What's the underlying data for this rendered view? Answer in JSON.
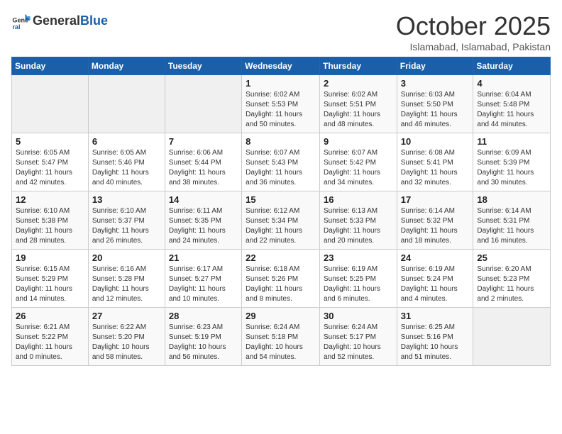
{
  "header": {
    "logo_general": "General",
    "logo_blue": "Blue",
    "month": "October 2025",
    "location": "Islamabad, Islamabad, Pakistan"
  },
  "weekdays": [
    "Sunday",
    "Monday",
    "Tuesday",
    "Wednesday",
    "Thursday",
    "Friday",
    "Saturday"
  ],
  "weeks": [
    [
      {
        "day": "",
        "info": ""
      },
      {
        "day": "",
        "info": ""
      },
      {
        "day": "",
        "info": ""
      },
      {
        "day": "1",
        "info": "Sunrise: 6:02 AM\nSunset: 5:53 PM\nDaylight: 11 hours\nand 50 minutes."
      },
      {
        "day": "2",
        "info": "Sunrise: 6:02 AM\nSunset: 5:51 PM\nDaylight: 11 hours\nand 48 minutes."
      },
      {
        "day": "3",
        "info": "Sunrise: 6:03 AM\nSunset: 5:50 PM\nDaylight: 11 hours\nand 46 minutes."
      },
      {
        "day": "4",
        "info": "Sunrise: 6:04 AM\nSunset: 5:48 PM\nDaylight: 11 hours\nand 44 minutes."
      }
    ],
    [
      {
        "day": "5",
        "info": "Sunrise: 6:05 AM\nSunset: 5:47 PM\nDaylight: 11 hours\nand 42 minutes."
      },
      {
        "day": "6",
        "info": "Sunrise: 6:05 AM\nSunset: 5:46 PM\nDaylight: 11 hours\nand 40 minutes."
      },
      {
        "day": "7",
        "info": "Sunrise: 6:06 AM\nSunset: 5:44 PM\nDaylight: 11 hours\nand 38 minutes."
      },
      {
        "day": "8",
        "info": "Sunrise: 6:07 AM\nSunset: 5:43 PM\nDaylight: 11 hours\nand 36 minutes."
      },
      {
        "day": "9",
        "info": "Sunrise: 6:07 AM\nSunset: 5:42 PM\nDaylight: 11 hours\nand 34 minutes."
      },
      {
        "day": "10",
        "info": "Sunrise: 6:08 AM\nSunset: 5:41 PM\nDaylight: 11 hours\nand 32 minutes."
      },
      {
        "day": "11",
        "info": "Sunrise: 6:09 AM\nSunset: 5:39 PM\nDaylight: 11 hours\nand 30 minutes."
      }
    ],
    [
      {
        "day": "12",
        "info": "Sunrise: 6:10 AM\nSunset: 5:38 PM\nDaylight: 11 hours\nand 28 minutes."
      },
      {
        "day": "13",
        "info": "Sunrise: 6:10 AM\nSunset: 5:37 PM\nDaylight: 11 hours\nand 26 minutes."
      },
      {
        "day": "14",
        "info": "Sunrise: 6:11 AM\nSunset: 5:35 PM\nDaylight: 11 hours\nand 24 minutes."
      },
      {
        "day": "15",
        "info": "Sunrise: 6:12 AM\nSunset: 5:34 PM\nDaylight: 11 hours\nand 22 minutes."
      },
      {
        "day": "16",
        "info": "Sunrise: 6:13 AM\nSunset: 5:33 PM\nDaylight: 11 hours\nand 20 minutes."
      },
      {
        "day": "17",
        "info": "Sunrise: 6:14 AM\nSunset: 5:32 PM\nDaylight: 11 hours\nand 18 minutes."
      },
      {
        "day": "18",
        "info": "Sunrise: 6:14 AM\nSunset: 5:31 PM\nDaylight: 11 hours\nand 16 minutes."
      }
    ],
    [
      {
        "day": "19",
        "info": "Sunrise: 6:15 AM\nSunset: 5:29 PM\nDaylight: 11 hours\nand 14 minutes."
      },
      {
        "day": "20",
        "info": "Sunrise: 6:16 AM\nSunset: 5:28 PM\nDaylight: 11 hours\nand 12 minutes."
      },
      {
        "day": "21",
        "info": "Sunrise: 6:17 AM\nSunset: 5:27 PM\nDaylight: 11 hours\nand 10 minutes."
      },
      {
        "day": "22",
        "info": "Sunrise: 6:18 AM\nSunset: 5:26 PM\nDaylight: 11 hours\nand 8 minutes."
      },
      {
        "day": "23",
        "info": "Sunrise: 6:19 AM\nSunset: 5:25 PM\nDaylight: 11 hours\nand 6 minutes."
      },
      {
        "day": "24",
        "info": "Sunrise: 6:19 AM\nSunset: 5:24 PM\nDaylight: 11 hours\nand 4 minutes."
      },
      {
        "day": "25",
        "info": "Sunrise: 6:20 AM\nSunset: 5:23 PM\nDaylight: 11 hours\nand 2 minutes."
      }
    ],
    [
      {
        "day": "26",
        "info": "Sunrise: 6:21 AM\nSunset: 5:22 PM\nDaylight: 11 hours\nand 0 minutes."
      },
      {
        "day": "27",
        "info": "Sunrise: 6:22 AM\nSunset: 5:20 PM\nDaylight: 10 hours\nand 58 minutes."
      },
      {
        "day": "28",
        "info": "Sunrise: 6:23 AM\nSunset: 5:19 PM\nDaylight: 10 hours\nand 56 minutes."
      },
      {
        "day": "29",
        "info": "Sunrise: 6:24 AM\nSunset: 5:18 PM\nDaylight: 10 hours\nand 54 minutes."
      },
      {
        "day": "30",
        "info": "Sunrise: 6:24 AM\nSunset: 5:17 PM\nDaylight: 10 hours\nand 52 minutes."
      },
      {
        "day": "31",
        "info": "Sunrise: 6:25 AM\nSunset: 5:16 PM\nDaylight: 10 hours\nand 51 minutes."
      },
      {
        "day": "",
        "info": ""
      }
    ]
  ]
}
